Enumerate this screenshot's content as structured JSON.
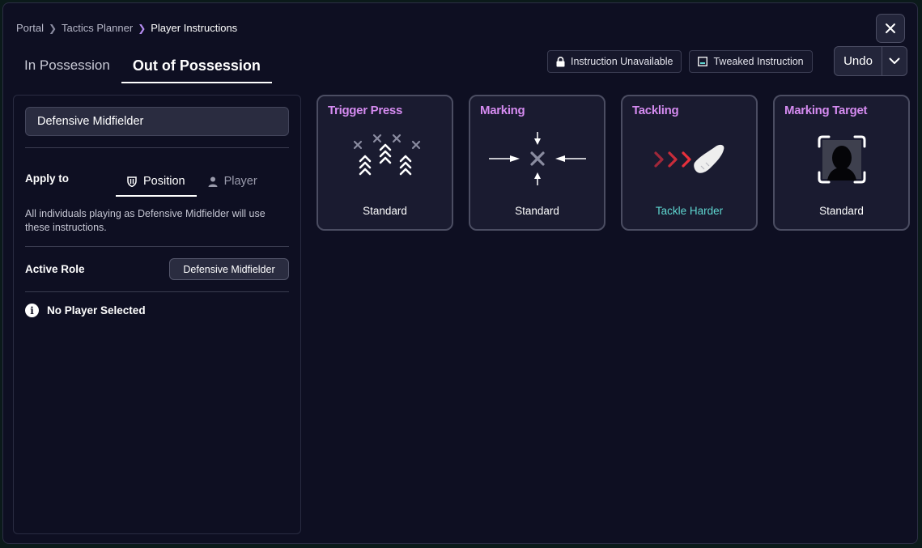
{
  "breadcrumb": {
    "items": [
      "Portal",
      "Tactics Planner",
      "Player Instructions"
    ]
  },
  "tabs": [
    {
      "label": "In Possession",
      "active": false
    },
    {
      "label": "Out of Possession",
      "active": true
    }
  ],
  "legend": {
    "unavailable": "Instruction Unavailable",
    "tweaked": "Tweaked Instruction"
  },
  "undo": {
    "label": "Undo"
  },
  "sidebar": {
    "position_field": "Defensive Midfielder",
    "apply_to_label": "Apply to",
    "apply_options": [
      {
        "label": "Position",
        "active": true
      },
      {
        "label": "Player",
        "active": false
      }
    ],
    "apply_description": "All individuals playing as Defensive Midfielder will use these instructions.",
    "active_role_label": "Active Role",
    "active_role_value": "Defensive Midfielder",
    "no_player": "No Player Selected"
  },
  "cards": [
    {
      "title": "Trigger Press",
      "value": "Standard",
      "tweaked": false,
      "icon": "trigger-press-icon"
    },
    {
      "title": "Marking",
      "value": "Standard",
      "tweaked": false,
      "icon": "marking-icon"
    },
    {
      "title": "Tackling",
      "value": "Tackle Harder",
      "tweaked": true,
      "icon": "tackling-icon"
    },
    {
      "title": "Marking Target",
      "value": "Standard",
      "tweaked": false,
      "icon": "marking-target-icon"
    }
  ],
  "colors": {
    "accent_title": "#d58bf0",
    "tweaked_value": "#5fd6d0",
    "background": "#0e0f22",
    "card_bg": "#1a1b30",
    "tackle_arrows": "#e0303a"
  }
}
